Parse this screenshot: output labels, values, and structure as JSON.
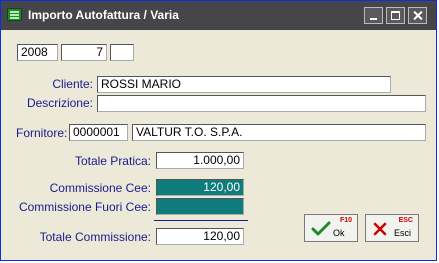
{
  "window": {
    "title": "Importo Autofattura / Varia"
  },
  "period": {
    "year": "2008",
    "number": "7",
    "extra": ""
  },
  "cliente": {
    "label": "Cliente:",
    "value": "ROSSI MARIO"
  },
  "descrizione": {
    "label": "Descrizione:",
    "value": ""
  },
  "fornitore": {
    "label": "Fornitore:",
    "code": "0000001",
    "name": "VALTUR T.O. S.P.A."
  },
  "totale_pratica": {
    "label": "Totale Pratica:",
    "value": "1.000,00"
  },
  "commissione_cee": {
    "label": "Commissione Cee:",
    "value": "120,00"
  },
  "commissione_fuori_cee": {
    "label": "Commissione Fuori Cee:",
    "value": ""
  },
  "totale_commissione": {
    "label": "Totale Commissione:",
    "value": "120,00"
  },
  "buttons": {
    "ok": {
      "key": "F10",
      "label": "Ok"
    },
    "esci": {
      "key": "ESC",
      "label": "Esci"
    }
  },
  "colors": {
    "titlebar": "#46464a",
    "highlight_field": "#0f7b7b",
    "label_text": "#1a1a8c"
  },
  "icons": {
    "app": "green-form-icon",
    "ok": "check-icon",
    "esci": "x-icon"
  }
}
